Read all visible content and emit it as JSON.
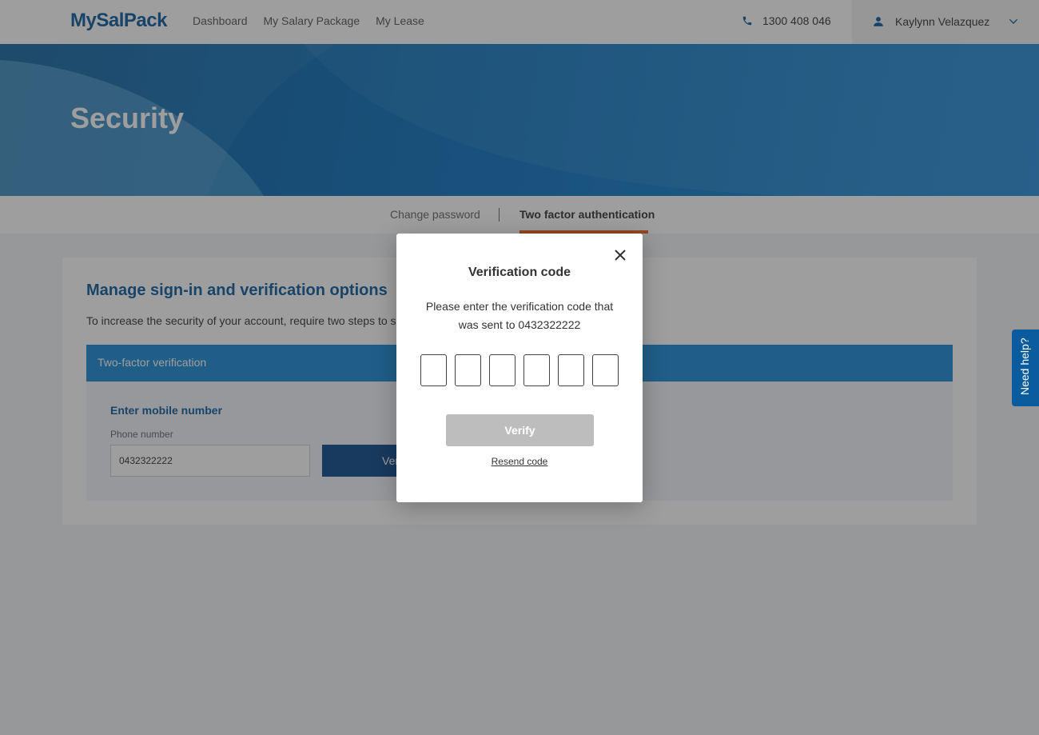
{
  "header": {
    "logo": "MySalPack",
    "nav": [
      "Dashboard",
      "My Salary Package",
      "My Lease"
    ],
    "phone": "1300 408 046",
    "user_name": "Kaylynn Velazquez"
  },
  "hero": {
    "title": "Security"
  },
  "tabs": {
    "change_password": "Change password",
    "two_factor": "Two factor authentication"
  },
  "card": {
    "heading": "Manage sign-in and verification options",
    "description": "To increase the security of your account, require two steps to s",
    "band_title": "Two-factor verification",
    "enter_mobile": "Enter mobile number",
    "phone_label": "Phone number",
    "phone_value": "0432322222",
    "verify_label": "Ver"
  },
  "help": {
    "label": "Need help?"
  },
  "modal": {
    "title": "Verification code",
    "text": "Please enter the verification code that was sent to 0432322222",
    "verify_label": "Verify",
    "resend_label": "Resend code"
  },
  "colors": {
    "brand": "#0b5c9e",
    "accent": "#e8641b",
    "band": "#1a8ad8"
  }
}
